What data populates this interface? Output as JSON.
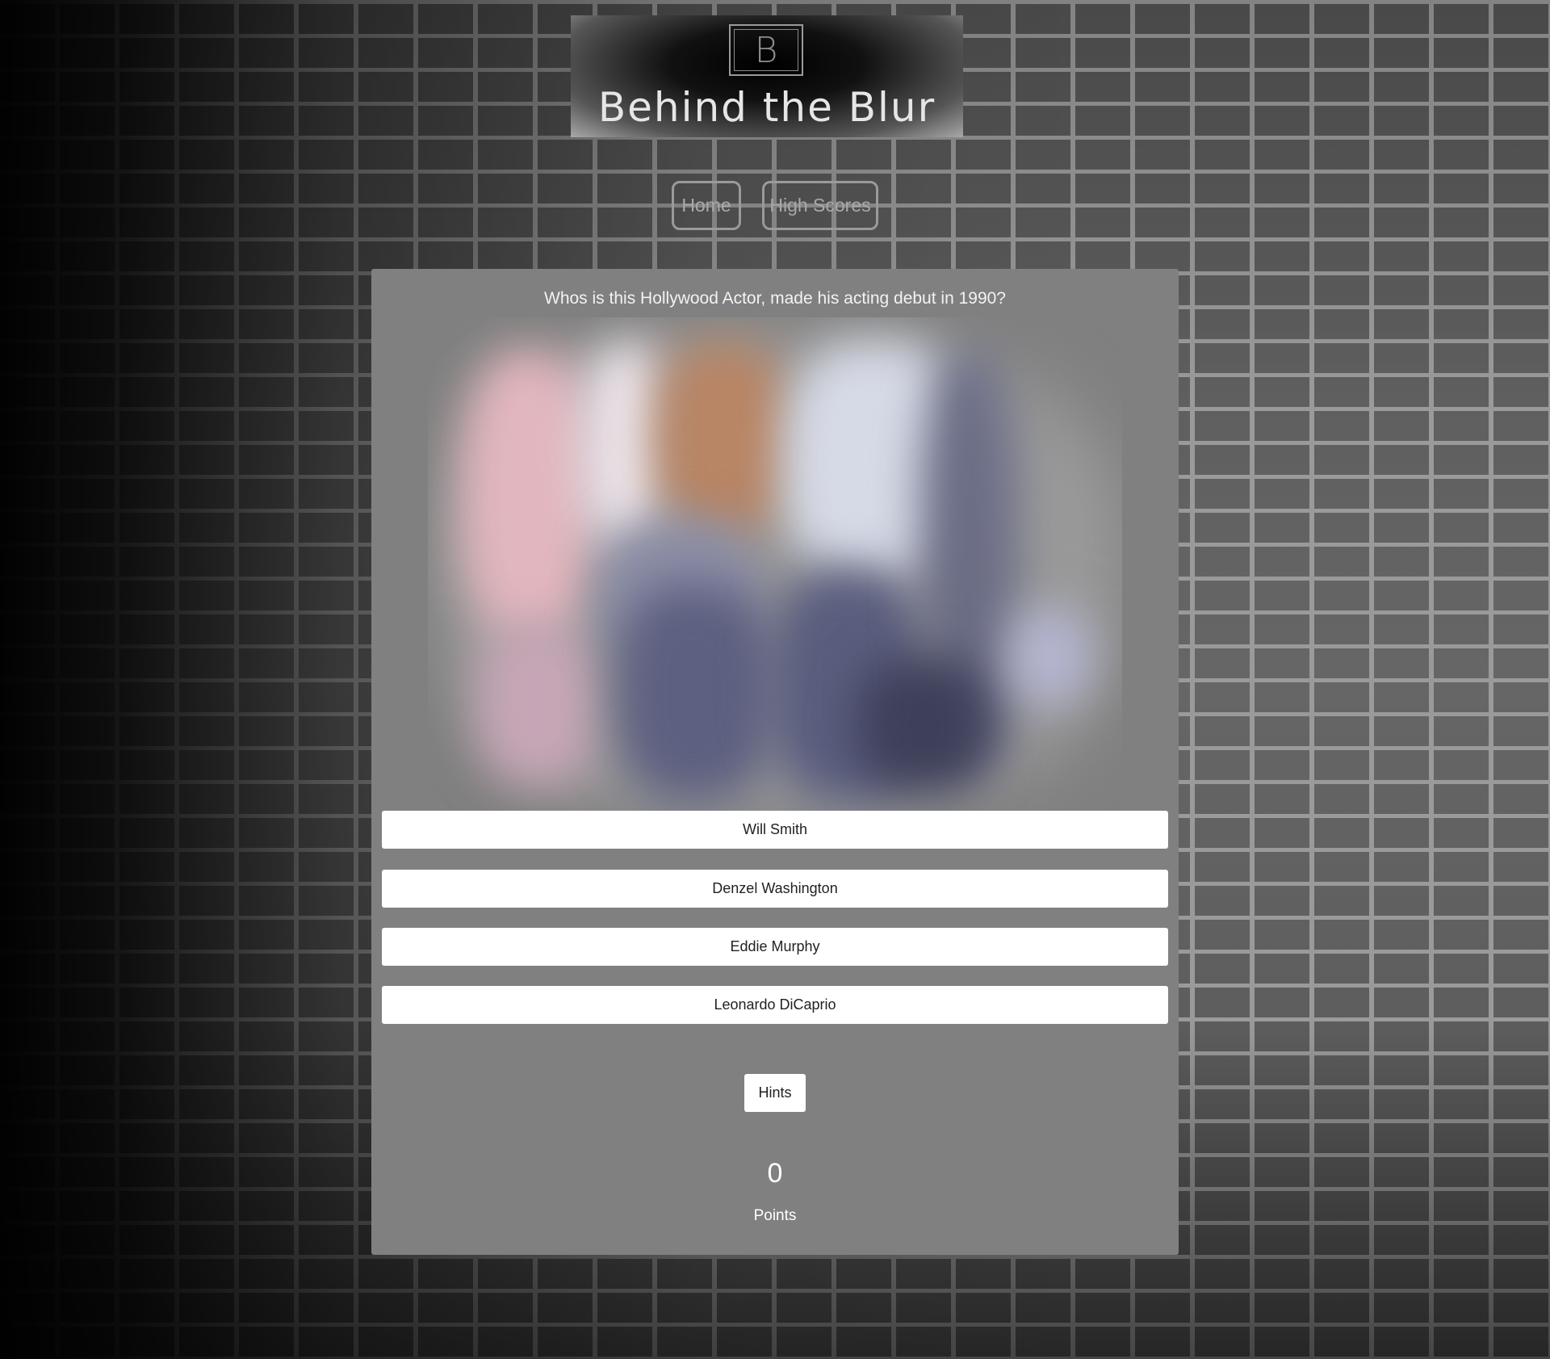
{
  "header": {
    "logo_letter": "B",
    "logo_title": "Behind the Blur"
  },
  "nav": {
    "home_label": "Home",
    "high_scores_label": "High Scores"
  },
  "quiz": {
    "question": "Whos is this Hollywood Actor, made his acting debut in 1990?",
    "answers": [
      "Will Smith",
      "Denzel Washington",
      "Eddie Murphy",
      "Leonardo DiCaprio"
    ],
    "hints_label": "Hints"
  },
  "score": {
    "value": "0",
    "label": "Points"
  },
  "colors": {
    "panel": "#808080",
    "button": "#ffffff",
    "nav_border": "#9a9a9a"
  }
}
